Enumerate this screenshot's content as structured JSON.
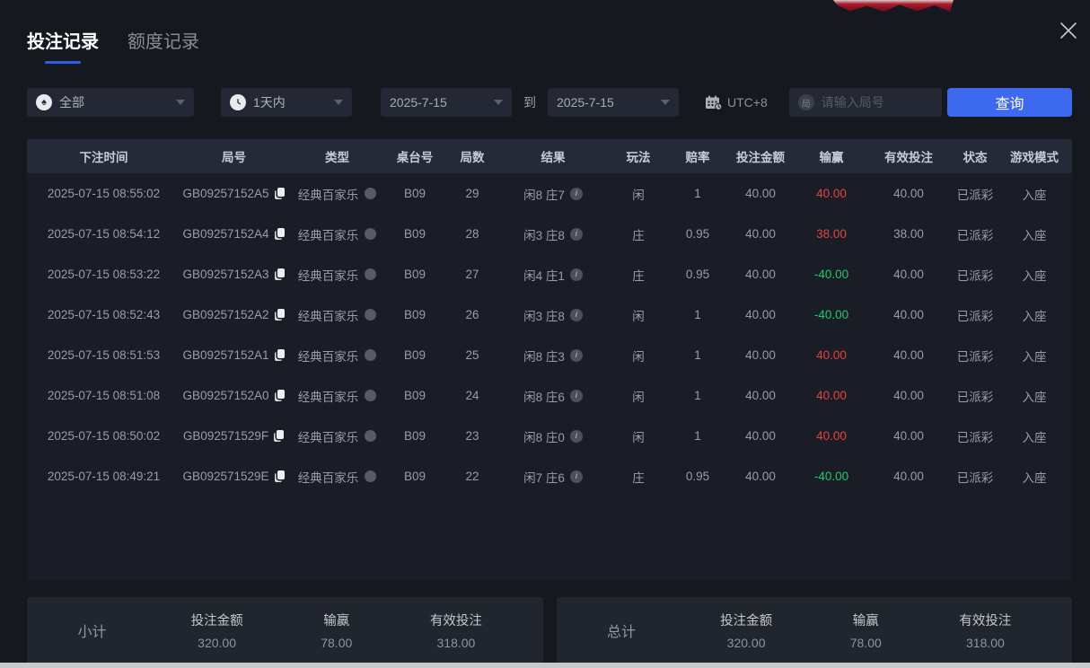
{
  "tabs": [
    {
      "label": "投注记录",
      "active": true
    },
    {
      "label": "额度记录",
      "active": false
    }
  ],
  "filters": {
    "game_type": {
      "value": "全部"
    },
    "time_range": {
      "value": "1天内"
    },
    "date_from": "2025-7-15",
    "to_label": "到",
    "date_to": "2025-7-15",
    "timezone": {
      "label": "UTC+8"
    },
    "search": {
      "badge": "局",
      "placeholder": "请输入局号",
      "value": ""
    },
    "query_button": "查询"
  },
  "icons": {
    "spade": "♠",
    "info": "i"
  },
  "table": {
    "columns": [
      "下注时间",
      "局号",
      "类型",
      "桌台号",
      "局数",
      "结果",
      "玩法",
      "赔率",
      "投注金额",
      "输赢",
      "有效投注",
      "状态",
      "游戏模式"
    ],
    "rows": [
      {
        "time": "2025-07-15 08:55:02",
        "game_id": "GB09257152A5",
        "type": "经典百家乐",
        "table_no": "B09",
        "rounds": "29",
        "result": "闲8 庄7",
        "play": "闲",
        "odds": "1",
        "bet_amount": "40.00",
        "win_loss": "40.00",
        "win_loss_color": "red",
        "valid_bet": "40.00",
        "status": "已派彩",
        "mode": "入座"
      },
      {
        "time": "2025-07-15 08:54:12",
        "game_id": "GB09257152A4",
        "type": "经典百家乐",
        "table_no": "B09",
        "rounds": "28",
        "result": "闲3 庄8",
        "play": "庄",
        "odds": "0.95",
        "bet_amount": "40.00",
        "win_loss": "38.00",
        "win_loss_color": "red",
        "valid_bet": "38.00",
        "status": "已派彩",
        "mode": "入座"
      },
      {
        "time": "2025-07-15 08:53:22",
        "game_id": "GB09257152A3",
        "type": "经典百家乐",
        "table_no": "B09",
        "rounds": "27",
        "result": "闲4 庄1",
        "play": "庄",
        "odds": "0.95",
        "bet_amount": "40.00",
        "win_loss": "-40.00",
        "win_loss_color": "green",
        "valid_bet": "40.00",
        "status": "已派彩",
        "mode": "入座"
      },
      {
        "time": "2025-07-15 08:52:43",
        "game_id": "GB09257152A2",
        "type": "经典百家乐",
        "table_no": "B09",
        "rounds": "26",
        "result": "闲3 庄8",
        "play": "闲",
        "odds": "1",
        "bet_amount": "40.00",
        "win_loss": "-40.00",
        "win_loss_color": "green",
        "valid_bet": "40.00",
        "status": "已派彩",
        "mode": "入座"
      },
      {
        "time": "2025-07-15 08:51:53",
        "game_id": "GB09257152A1",
        "type": "经典百家乐",
        "table_no": "B09",
        "rounds": "25",
        "result": "闲8 庄3",
        "play": "闲",
        "odds": "1",
        "bet_amount": "40.00",
        "win_loss": "40.00",
        "win_loss_color": "red",
        "valid_bet": "40.00",
        "status": "已派彩",
        "mode": "入座"
      },
      {
        "time": "2025-07-15 08:51:08",
        "game_id": "GB09257152A0",
        "type": "经典百家乐",
        "table_no": "B09",
        "rounds": "24",
        "result": "闲8 庄6",
        "play": "闲",
        "odds": "1",
        "bet_amount": "40.00",
        "win_loss": "40.00",
        "win_loss_color": "red",
        "valid_bet": "40.00",
        "status": "已派彩",
        "mode": "入座"
      },
      {
        "time": "2025-07-15 08:50:02",
        "game_id": "GB092571529F",
        "type": "经典百家乐",
        "table_no": "B09",
        "rounds": "23",
        "result": "闲8 庄0",
        "play": "闲",
        "odds": "1",
        "bet_amount": "40.00",
        "win_loss": "40.00",
        "win_loss_color": "red",
        "valid_bet": "40.00",
        "status": "已派彩",
        "mode": "入座"
      },
      {
        "time": "2025-07-15 08:49:21",
        "game_id": "GB092571529E",
        "type": "经典百家乐",
        "table_no": "B09",
        "rounds": "22",
        "result": "闲7 庄6",
        "play": "庄",
        "odds": "0.95",
        "bet_amount": "40.00",
        "win_loss": "-40.00",
        "win_loss_color": "green",
        "valid_bet": "40.00",
        "status": "已派彩",
        "mode": "入座"
      }
    ]
  },
  "summary": {
    "subtotal": {
      "label": "小计",
      "items": [
        {
          "label": "投注金额",
          "value": "320.00",
          "color": "gray"
        },
        {
          "label": "输赢",
          "value": "78.00",
          "color": "red"
        },
        {
          "label": "有效投注",
          "value": "318.00",
          "color": "gray"
        }
      ]
    },
    "total": {
      "label": "总计",
      "items": [
        {
          "label": "投注金额",
          "value": "320.00",
          "color": "gray"
        },
        {
          "label": "输赢",
          "value": "78.00",
          "color": "red"
        },
        {
          "label": "有效投注",
          "value": "318.00",
          "color": "gray"
        }
      ]
    }
  },
  "colors": {
    "accent_blue": "#3c69ee",
    "tab_underline_blue": "#2f5de8",
    "win_red": "#df4540",
    "loss_green": "#1fc96a"
  }
}
